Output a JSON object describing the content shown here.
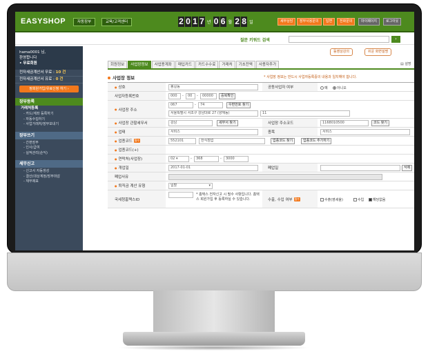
{
  "header": {
    "logo": "EASYSHOP",
    "nav": [
      "자동장부",
      "교육/고객센터"
    ],
    "date": {
      "year": "2017",
      "year_label": "년",
      "month": "06",
      "month_label": "월",
      "day": "28",
      "day_label": "일"
    },
    "orange_buttons": [
      "세무상담",
      "장부사용문의",
      "답변",
      "전화문의"
    ],
    "grey_buttons": [
      "마이페이지",
      "로그아웃"
    ]
  },
  "search": {
    "label": "질문 키워드 검색",
    "button": "›"
  },
  "sidebar": {
    "user_line1": "hama0001 님,",
    "user_line2": "환영합니다",
    "plan": "• 무료회원",
    "stat1_label": "전자세금계산서 무료 : ",
    "stat1_value": "10 건",
    "stat2_label": "전자세금계산서 유료 : ",
    "stat2_value": "0 건",
    "upgrade_button": "정회원가입/유료신청 하기 ›",
    "sections": [
      {
        "title": "장부등록",
        "subhead": "거래처등록",
        "items": [
          "- 카드/계좌 등록하기",
          "- 자동수집하기",
          "- 사업거래처/장부보내기"
        ]
      },
      {
        "title": "장부쓰기",
        "items": [
          "- 간편장부",
          "- 인사/급여",
          "- 실적관리(순익)"
        ]
      },
      {
        "title": "세무신고",
        "items": [
          "- 신고서 자동생성",
          "- 결산(대상계정/장부마감",
          "- 재무제표"
        ]
      }
    ]
  },
  "main": {
    "top_buttons": [
      "동영상강의",
      "쉬운 화면설명"
    ],
    "tabs": [
      "회원정보",
      "사업장정보",
      "사업용계좌",
      "매입카드",
      "카드수수료",
      "거래처",
      "기초잔액",
      "사용자추가"
    ],
    "help": "설명",
    "section_title": "사업장 정보",
    "note": "* 사업장 정보는 반드시 사업자등록증의 내용과 일치해야 합니다.",
    "form": {
      "name_label": "상호",
      "name_value": "봉길동",
      "joint_label": "공동사업자 여부",
      "joint_yes": "예",
      "joint_no": "아니오",
      "bizno_label": "사업자등록번호",
      "bizno1": "000",
      "bizno2": "00",
      "bizno3": "00000",
      "bizno_button": "중복확인",
      "addr_label": "사업장 주소",
      "zip1": "067",
      "zip2": "74",
      "zip_button": "우편번호 찾기",
      "addr1": "서울특별시 서초구 강남대로 27 (양재동)",
      "addr2": "11",
      "tax_office_label": "사업장 관할세무서",
      "tax_office_value": "강남",
      "tax_office_button": "세무서 찾기",
      "addr_code_label": "사업장 주소코드",
      "addr_code_value": "1168010500",
      "addr_code_button": "코드 찾기",
      "biz_type_label": "업태",
      "biz_type_value": "서비스",
      "item_label": "종목",
      "item_value": "서비스",
      "industry_label": "업종코드",
      "industry_badge": "필수",
      "industry_code": "552101",
      "industry_name": "한식점업",
      "industry_find": "업종코드 찾기",
      "industry_add": "업종코드 추가하기",
      "industry_plus_label": "업종코드(+)",
      "phone_label": "연락처(사업장)",
      "phone1": "02",
      "phone2": "368",
      "phone3": "3000",
      "open_label": "개업일",
      "open_value": "2017-01-01",
      "close_label": "폐업일",
      "close_button": "삭제",
      "close_reason_label": "폐업사유",
      "retire_label": "퇴직금 계산 유형",
      "retire_value": "일할",
      "customs_label": "국세청홈택스ID",
      "customs_note": "* 홈택스 전자신고 시 필수 사항입니다. 홈택스 회원가입 후 등록하실 수 있습니다.",
      "export_label": "수출, 수입 여부",
      "export_badge": "필수",
      "export_opt1": "수출(영세율)",
      "export_opt2": "수입",
      "export_opt3": "해당없음"
    }
  }
}
